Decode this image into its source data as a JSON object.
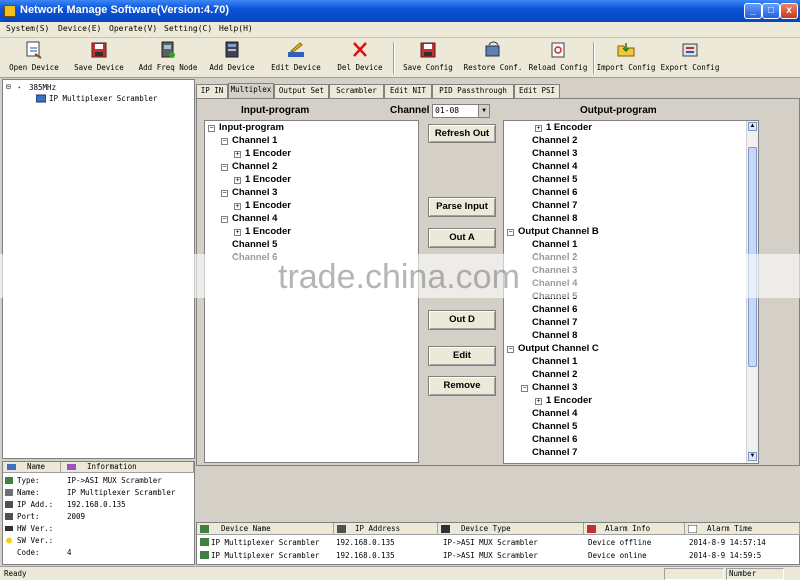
{
  "window": {
    "title": "Network Manage Software(Version:4.70)",
    "minimize": "_",
    "maximize": "□",
    "close": "x"
  },
  "menu": [
    "System(S)",
    "Device(E)",
    "Operate(V)",
    "Setting(C)",
    "Help(H)"
  ],
  "toolbar": [
    {
      "label": "Open Device",
      "icon": "open-device-icon"
    },
    {
      "label": "Save Device",
      "icon": "save-device-icon"
    },
    {
      "label": "Add Freq Node",
      "icon": "add-freq-node-icon"
    },
    {
      "label": "Add Device",
      "icon": "add-device-icon"
    },
    {
      "label": "Edit Device",
      "icon": "edit-device-icon"
    },
    {
      "label": "Del Device",
      "icon": "delete-icon"
    },
    {
      "label": "Save Config",
      "icon": "save-config-icon"
    },
    {
      "label": "Restore Conf.",
      "icon": "restore-config-icon"
    },
    {
      "label": "Reload Config",
      "icon": "reload-config-icon"
    },
    {
      "label": "Import Config",
      "icon": "import-config-icon"
    },
    {
      "label": "Export Config",
      "icon": "export-config-icon"
    }
  ],
  "left_tree": {
    "root": "385MHz",
    "child": "IP Multiplexer Scrambler",
    "expander": "⊟"
  },
  "properties": {
    "headers": [
      "Name",
      "Information"
    ],
    "rows": [
      {
        "k": "Type:",
        "v": "IP->ASI MUX Scrambler"
      },
      {
        "k": "Name:",
        "v": "IP Multiplexer Scrambler"
      },
      {
        "k": "IP Add.:",
        "v": "192.168.0.135"
      },
      {
        "k": "Port:",
        "v": "2009"
      },
      {
        "k": "HW Ver.:",
        "v": ""
      },
      {
        "k": "SW Ver.:",
        "v": ""
      },
      {
        "k": "Code:",
        "v": "4"
      }
    ]
  },
  "tabs": [
    "IP IN",
    "Multiplex",
    "Output Set",
    "Scrambler",
    "Edit NIT",
    "PID Passthrough",
    "Edit PSI"
  ],
  "active_tab": "Multiplex",
  "multiplex": {
    "input_title": "Input-program",
    "output_title": "Output-program",
    "channel_label": "Channel",
    "channel_value": "01-08",
    "buttons": [
      "Refresh Out",
      "Parse Input",
      "Out A",
      "Out D",
      "Edit",
      "Remove"
    ],
    "input_tree": [
      {
        "text": "Input-program",
        "level": 0,
        "exp": "-"
      },
      {
        "text": "Channel 1",
        "level": 1,
        "exp": "-"
      },
      {
        "text": "1 Encoder",
        "level": 2,
        "exp": "+"
      },
      {
        "text": "Channel 2",
        "level": 1,
        "exp": "-"
      },
      {
        "text": "1 Encoder",
        "level": 2,
        "exp": "+"
      },
      {
        "text": "Channel 3",
        "level": 1,
        "exp": "-"
      },
      {
        "text": "1 Encoder",
        "level": 2,
        "exp": "+"
      },
      {
        "text": "Channel 4",
        "level": 1,
        "exp": "-"
      },
      {
        "text": "1 Encoder",
        "level": 2,
        "exp": "+"
      },
      {
        "text": "Channel 5",
        "level": 1,
        "exp": ""
      },
      {
        "text": "Channel 6",
        "level": 1,
        "exp": ""
      }
    ],
    "output_tree": [
      {
        "text": "1 Encoder",
        "level": 2,
        "exp": "+"
      },
      {
        "text": "Channel 2",
        "level": 1,
        "exp": ""
      },
      {
        "text": "Channel 3",
        "level": 1,
        "exp": ""
      },
      {
        "text": "Channel 4",
        "level": 1,
        "exp": ""
      },
      {
        "text": "Channel 5",
        "level": 1,
        "exp": ""
      },
      {
        "text": "Channel 6",
        "level": 1,
        "exp": ""
      },
      {
        "text": "Channel 7",
        "level": 1,
        "exp": ""
      },
      {
        "text": "Channel 8",
        "level": 1,
        "exp": ""
      },
      {
        "text": "Output Channel B",
        "level": 0,
        "exp": "-"
      },
      {
        "text": "Channel 1",
        "level": 1,
        "exp": ""
      },
      {
        "text": "Channel 2",
        "level": 1,
        "exp": ""
      },
      {
        "text": "Channel 3",
        "level": 1,
        "exp": ""
      },
      {
        "text": "Channel 4",
        "level": 1,
        "exp": ""
      },
      {
        "text": "Channel 5",
        "level": 1,
        "exp": ""
      },
      {
        "text": "Channel 6",
        "level": 1,
        "exp": ""
      },
      {
        "text": "Channel 7",
        "level": 1,
        "exp": ""
      },
      {
        "text": "Channel 8",
        "level": 1,
        "exp": ""
      },
      {
        "text": "Output Channel C",
        "level": 0,
        "exp": "-"
      },
      {
        "text": "Channel 1",
        "level": 1,
        "exp": ""
      },
      {
        "text": "Channel 2",
        "level": 1,
        "exp": ""
      },
      {
        "text": "Channel 3",
        "level": 1,
        "exp": "-"
      },
      {
        "text": "1 Encoder",
        "level": 2,
        "exp": "+"
      },
      {
        "text": "Channel 4",
        "level": 1,
        "exp": ""
      },
      {
        "text": "Channel 5",
        "level": 1,
        "exp": ""
      },
      {
        "text": "Channel 6",
        "level": 1,
        "exp": ""
      },
      {
        "text": "Channel 7",
        "level": 1,
        "exp": ""
      }
    ]
  },
  "watermark": "trade.china.com",
  "devices": {
    "headers": [
      "Device Name",
      "IP Address",
      "Device Type",
      "Alarm Info",
      "Alarm Time"
    ],
    "rows": [
      [
        "IP Multiplexer Scrambler",
        "192.168.0.135",
        "IP->ASI MUX Scrambler",
        "Device offline",
        "2014-8-9 14:57:14"
      ],
      [
        "IP Multiplexer Scrambler",
        "192.168.0.135",
        "IP->ASI MUX Scrambler",
        "Device online",
        "2014-8-9 14:59:5"
      ]
    ]
  },
  "status": {
    "text": "Ready",
    "num": "Number"
  }
}
